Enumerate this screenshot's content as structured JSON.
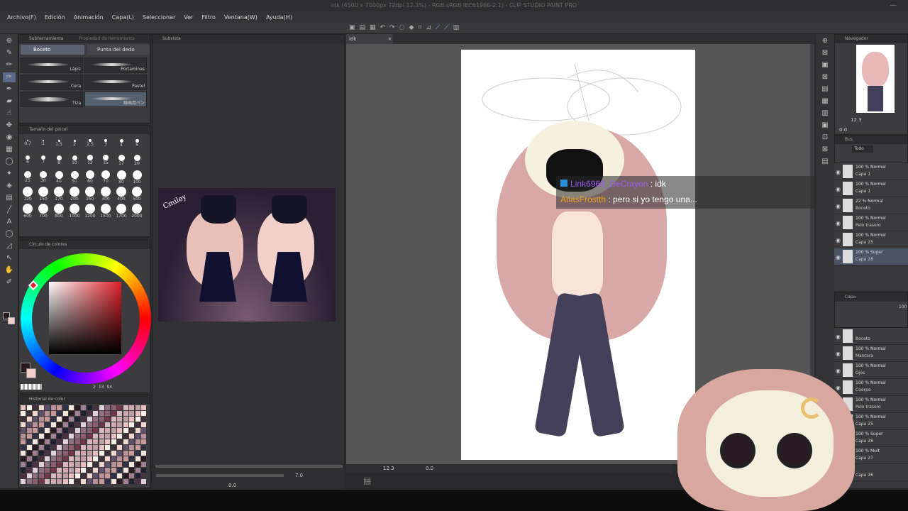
{
  "window": {
    "title": "idk (4500 x 7000px 72dpi 12.3%) - RGB sRGB IEC61966-2.1) - CLIP STUDIO PAINT PRO"
  },
  "menu": [
    "Archivo(F)",
    "Edición",
    "Animación",
    "Capa(L)",
    "Seleccionar",
    "Ver",
    "Filtro",
    "Ventana(W)",
    "Ayuda(H)"
  ],
  "subtool_panel": {
    "tabs": [
      "Subherramienta",
      "Propiedad de herramienta"
    ],
    "groups": [
      "Boceto",
      "Punta del dedo"
    ],
    "brushes": [
      "Lápiz",
      "Portaminas",
      "Cera",
      "Pastel",
      "Tiza",
      "線画用ペン"
    ]
  },
  "brush_size": {
    "header": "Tamaño del pincel",
    "sizes": [
      "0.7",
      "1",
      "1.5",
      "2",
      "2.5",
      "3",
      "4",
      "5",
      "6",
      "7",
      "8",
      "10",
      "12",
      "15",
      "17",
      "20",
      "25",
      "30",
      "40",
      "50",
      "60",
      "70",
      "80",
      "100",
      "120",
      "150",
      "170",
      "200",
      "250",
      "300",
      "400",
      "500",
      "600",
      "700",
      "800",
      "1000",
      "1200",
      "1500",
      "1700",
      "2000"
    ]
  },
  "color_wheel": {
    "header": "Círculo de colores",
    "values": [
      "2",
      "13",
      "94"
    ]
  },
  "color_history": {
    "header": "Historial de color"
  },
  "subview": {
    "tab": "Subvista"
  },
  "canvas": {
    "tab": "idk",
    "zoom": "12.3",
    "rotation": "0.0",
    "left_zoom": "7.0",
    "left_rot": "0.0"
  },
  "chat": [
    {
      "user": "Link6968_DeCrayon",
      "sep": " : ",
      "text": "idk",
      "color": "#9b5cf5"
    },
    {
      "user": "AtlasFrostth",
      "sep": " : ",
      "text": "pero si yo tengo una...",
      "color": "#f0a020"
    }
  ],
  "navigator": {
    "header": "Navegador",
    "zoom": "12.3",
    "rot": "0.0"
  },
  "layer_search": {
    "header": "Bus",
    "filter": "Todo"
  },
  "layers_top": [
    {
      "a": "100 % Normal",
      "b": "Capa 1"
    },
    {
      "a": "100 % Normal",
      "b": "Capa 1"
    },
    {
      "a": "22 % Normal",
      "b": "Boceto"
    },
    {
      "a": "100 % Normal",
      "b": "Pelo trasero"
    },
    {
      "a": "100 % Normal",
      "b": "Capa 25"
    },
    {
      "a": "100 % Super",
      "b": "Capa 28"
    }
  ],
  "layer_panel": {
    "header": "Capa",
    "opacity": "100"
  },
  "layers_bottom": [
    {
      "a": "",
      "b": "Boceto"
    },
    {
      "a": "100 % Normal",
      "b": "Mascara"
    },
    {
      "a": "100 % Normal",
      "b": "Ojos"
    },
    {
      "a": "100 % Normal",
      "b": "Cuerpo"
    },
    {
      "a": "100 % Normal",
      "b": "Pelo trasero"
    },
    {
      "a": "100 % Normal",
      "b": "Capa 25"
    },
    {
      "a": "100 % Super",
      "b": "Capa 28"
    },
    {
      "a": "100 % Mult",
      "b": "Capa 27"
    },
    {
      "a": "",
      "b": "Capa 26"
    }
  ],
  "artwork": {
    "signature": "Cmiley"
  }
}
